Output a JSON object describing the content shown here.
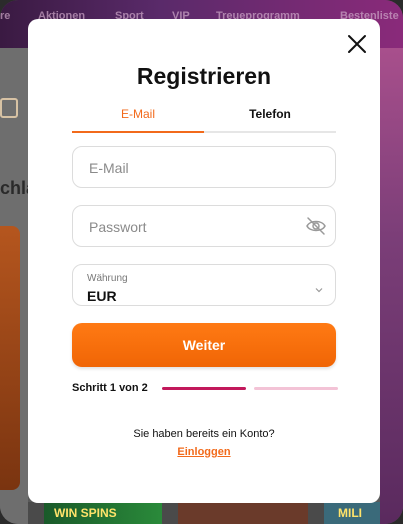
{
  "modal": {
    "title": "Registrieren",
    "tabs": [
      {
        "label": "E-Mail",
        "active": true
      },
      {
        "label": "Telefon",
        "active": false
      }
    ],
    "email": {
      "value": "",
      "placeholder": "E-Mail"
    },
    "password": {
      "value": "",
      "placeholder": "Passwort"
    },
    "currency": {
      "label": "Währung",
      "value": "EUR"
    },
    "continue_label": "Weiter",
    "step_text": "Schritt 1 von 2",
    "step_progress": 0.5,
    "have_account": "Sie haben bereits ein Konto?",
    "login_label": "Einloggen"
  },
  "background": {
    "nav": [
      "re",
      "Aktionen",
      "Sport",
      "VIP",
      "Treueprogramm",
      "Bestenliste"
    ],
    "partial_text": "chla",
    "bottom_tiles": [
      "WIN SPINS",
      "MILI"
    ]
  },
  "colors": {
    "accent": "#f26a1b",
    "progress_active": "#c2185b",
    "progress_inactive": "#f3c3d6"
  }
}
